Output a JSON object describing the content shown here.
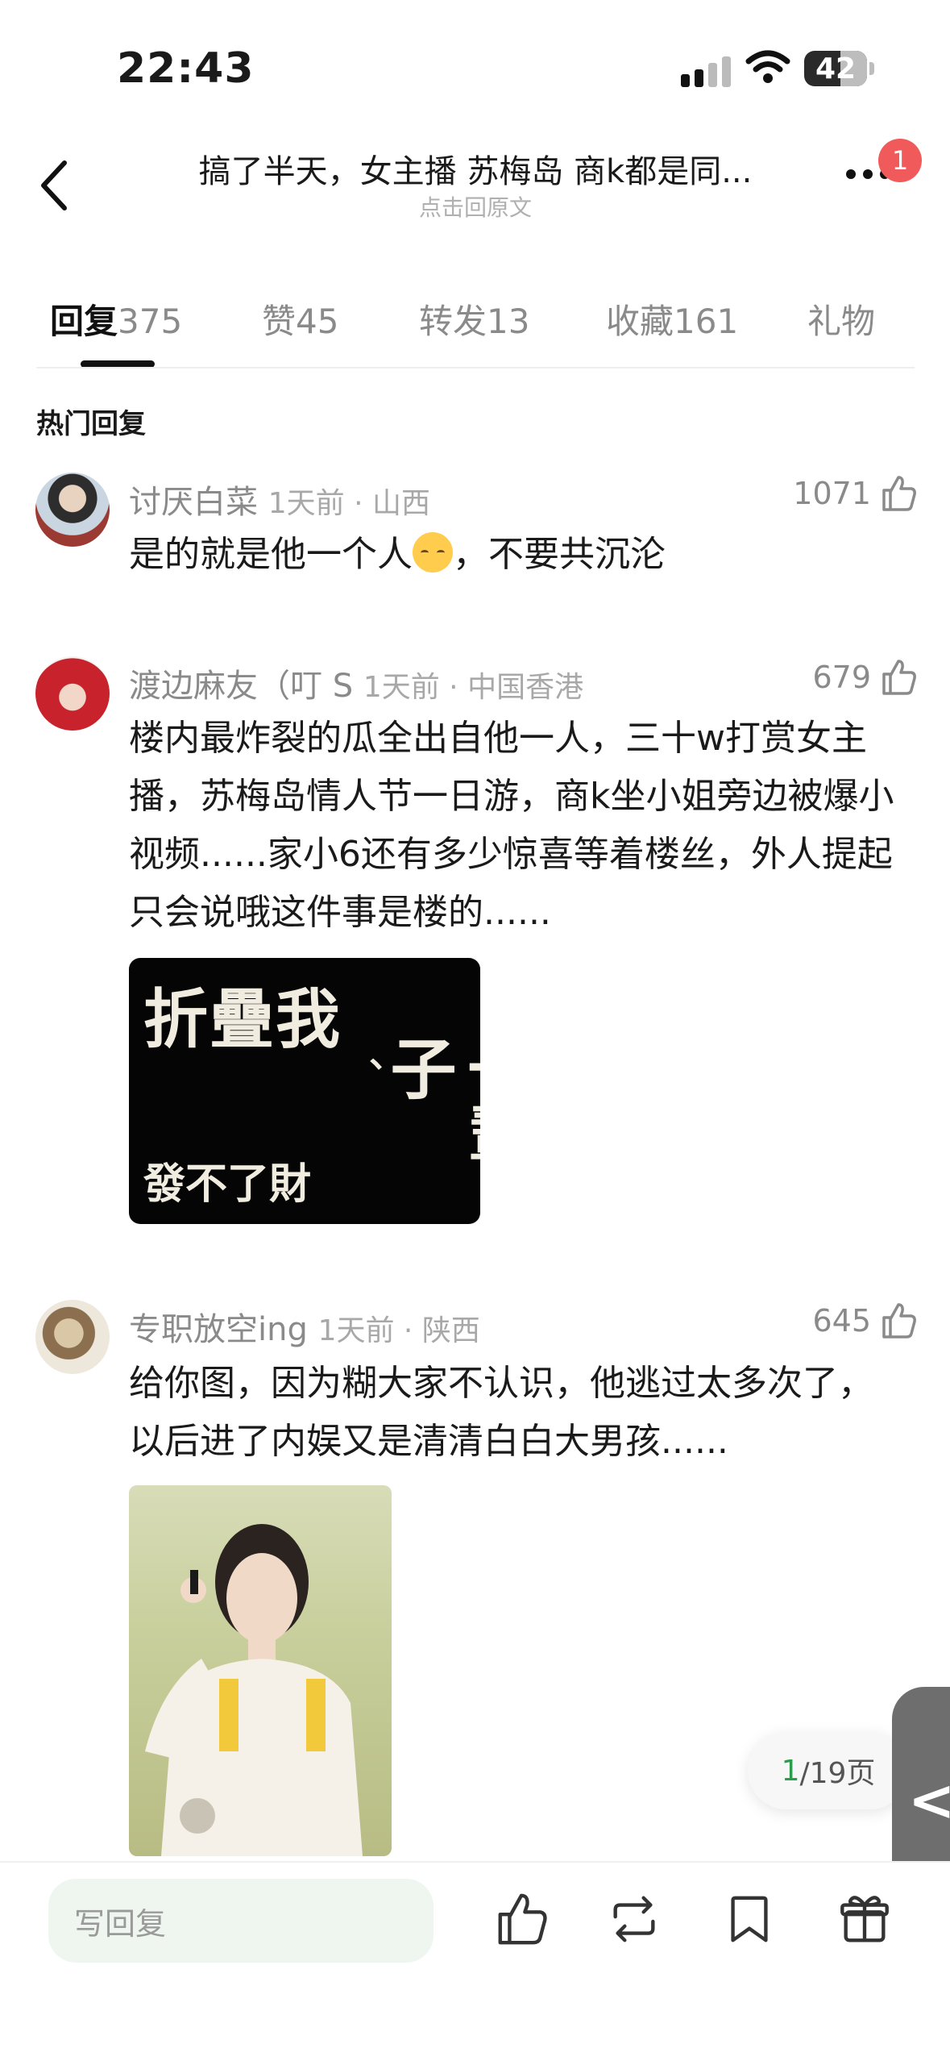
{
  "status_bar": {
    "time": "22:43",
    "battery": "42"
  },
  "header": {
    "title": "搞了半天，女主播 苏梅岛 商k都是同...",
    "subtitle": "点击回原文",
    "notification_count": "1"
  },
  "tabs": [
    {
      "label": "回复",
      "count": "375"
    },
    {
      "label": "赞",
      "count": "45"
    },
    {
      "label": "转发",
      "count": "13"
    },
    {
      "label": "收藏",
      "count": "161"
    },
    {
      "label": "礼物",
      "count": ""
    }
  ],
  "section_title": "热门回复",
  "comments": [
    {
      "user": "讨厌白菜",
      "time_location": "1天前 · 山西",
      "likes": "1071",
      "text_before_emoji": "是的就是他一个人",
      "text_after_emoji": "，不要共沉沦",
      "emoji": "pensive-face-emoji"
    },
    {
      "user": "渡边麻友（叮 S",
      "time_location": "1天前 · 中国香港",
      "likes": "679",
      "text": "楼内最炸裂的瓜全出自他一人，三十w打赏女主播，苏梅岛情人节一日游，商k坐小姐旁边被爆小视频......家小6还有多少惊喜等着楼丝，外人提起只会说哦这件事是楼的......",
      "image_text": {
        "line1": "折疊我",
        "comma": "、",
        "line2": "一輩子",
        "line3": "發不了財"
      }
    },
    {
      "user": "专职放空ing",
      "time_location": "1天前 · 陕西",
      "likes": "645",
      "text": "给你图，因为糊大家不认识，他逃过太多次了，以后进了内娱又是清清白白大男孩......"
    }
  ],
  "pagination": {
    "current": "1",
    "total": "/19页"
  },
  "side_handle": "<",
  "bottom_bar": {
    "reply_placeholder": "写回复"
  },
  "colors": {
    "accent_green": "#2c9d4c",
    "badge_red": "#f05a5a"
  }
}
